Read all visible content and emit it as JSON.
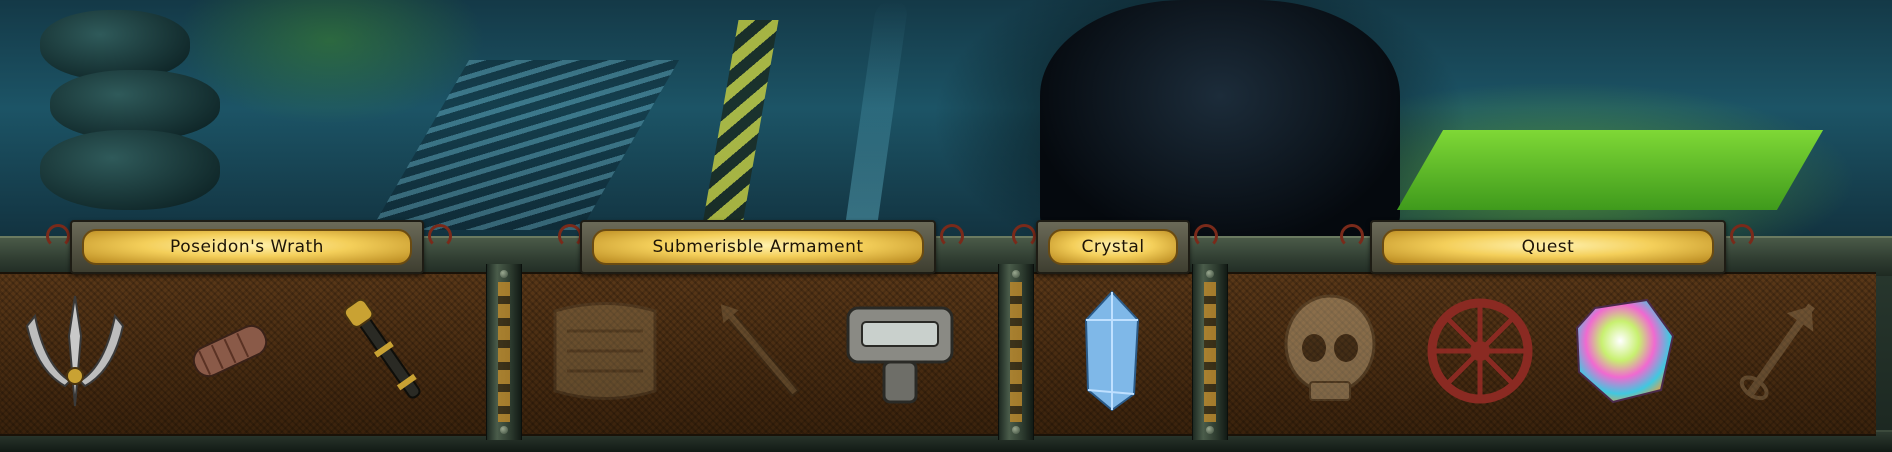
{
  "categories": [
    {
      "id": "poseidons-wrath",
      "label": "Poseidon's Wrath"
    },
    {
      "id": "submersible-armament",
      "label": "Submerisble Armament"
    },
    {
      "id": "crystal",
      "label": "Crystal"
    },
    {
      "id": "quest",
      "label": "Quest"
    }
  ],
  "items": [
    {
      "category": "poseidons-wrath",
      "icon": "trident-head-icon",
      "state": "owned"
    },
    {
      "category": "poseidons-wrath",
      "icon": "trident-shaft-icon",
      "state": "owned"
    },
    {
      "category": "poseidons-wrath",
      "icon": "trident-staff-icon",
      "state": "owned"
    },
    {
      "category": "submersible-armament",
      "icon": "armor-plate-icon",
      "state": "locked"
    },
    {
      "category": "submersible-armament",
      "icon": "harpoon-icon",
      "state": "locked"
    },
    {
      "category": "submersible-armament",
      "icon": "visor-helmet-icon",
      "state": "owned"
    },
    {
      "category": "crystal",
      "icon": "blue-crystal-icon",
      "state": "owned"
    },
    {
      "category": "quest",
      "icon": "skull-icon",
      "state": "locked"
    },
    {
      "category": "quest",
      "icon": "valve-wheel-icon",
      "state": "owned"
    },
    {
      "category": "quest",
      "icon": "rainbow-gem-icon",
      "state": "owned"
    },
    {
      "category": "quest",
      "icon": "key-dagger-icon",
      "state": "locked"
    }
  ],
  "colors": {
    "header_glow": "#f4cf5a",
    "panel_brown": "#4a2d12",
    "frame_green": "#2e3b30",
    "hazard_stripe": "#c08a2a"
  }
}
